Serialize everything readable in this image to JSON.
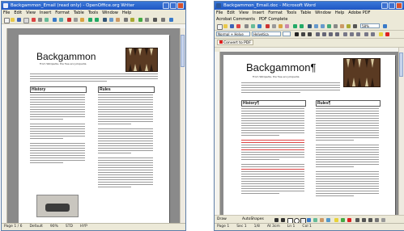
{
  "left_window": {
    "title": "Backgammon_Email (read only) - OpenOffice.org Writer",
    "menu": [
      "File",
      "Edit",
      "View",
      "Insert",
      "Format",
      "Table",
      "Tools",
      "Window",
      "Help"
    ],
    "document": {
      "heading": "Backgammon",
      "subheading": "From Wikipedia, the free encyclopedia",
      "section_history": "History",
      "section_rules": "Rules"
    },
    "status": [
      "Page 1 / 6",
      "Default",
      "90%",
      "STD",
      "HYP"
    ]
  },
  "right_window": {
    "title": "Backgammon_Email.doc - Microsoft Word",
    "menu": [
      "File",
      "Edit",
      "View",
      "Insert",
      "Format",
      "Tools",
      "Table",
      "Window",
      "Help",
      "Adobe PDF"
    ],
    "menu2": [
      "Acrobat Comments",
      "PDF Complete"
    ],
    "style_dropdown": "Normal + Helve",
    "font_dropdown": "Helvetica",
    "zoom": "58%",
    "convert_button": "Convert to PDF",
    "document": {
      "heading": "Backgammon¶",
      "subheading": "From Wikipedia, the free encyclopedia",
      "section_history": "History¶",
      "section_rules": "Rules¶"
    },
    "drawing_toolbar": {
      "draw": "Draw",
      "autoshapes": "AutoShapes"
    },
    "status": [
      "Page 1",
      "Sec 1",
      "1/8",
      "At 3cm",
      "Ln 1",
      "Col 1"
    ]
  }
}
